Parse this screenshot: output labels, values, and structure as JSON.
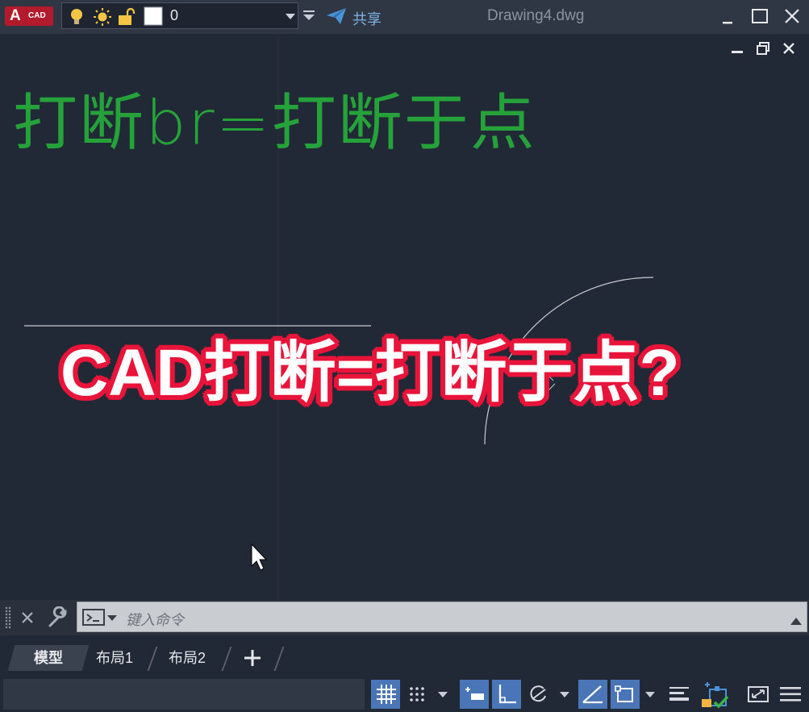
{
  "app": {
    "logo_letter": "A",
    "logo_text": "CAD",
    "document_title": "Drawing4.dwg"
  },
  "layer": {
    "current_name": "0",
    "color": "#ffffff"
  },
  "toolbar": {
    "share_label": "共享"
  },
  "drawing": {
    "watermark_text": "打断br=打断于点",
    "overlay_caption": "CAD打断=打断于点?"
  },
  "command": {
    "placeholder": "键入命令"
  },
  "tabs": [
    {
      "label": "模型",
      "active": true
    },
    {
      "label": "布局1"
    },
    {
      "label": "布局2"
    }
  ],
  "colors": {
    "brand": "#b31b2c",
    "active_status": "#4a76b8",
    "watermark": "#27b03c",
    "caption_outline": "#e8143a"
  }
}
